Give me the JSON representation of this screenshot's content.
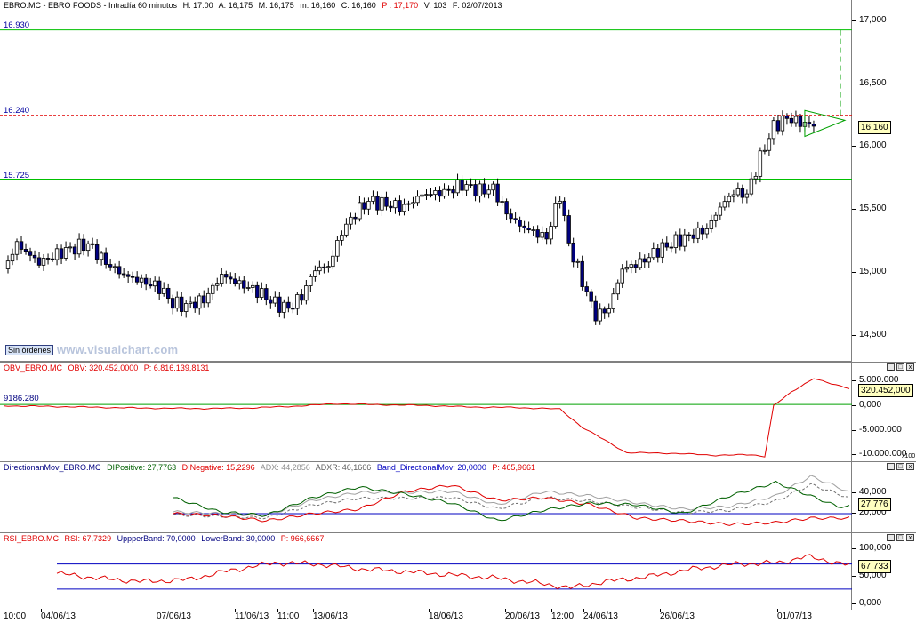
{
  "main": {
    "title_parts": [
      "EBRO.MC - EBRO FOODS - Intradía 60 minutos",
      "H: 17:00",
      "A: 16,175",
      "M: 16,175",
      "m: 16,160",
      "C: 16,160",
      "P : 17,170",
      "V: 103",
      "F: 02/07/2013"
    ],
    "y_ticks": [
      "17,000",
      "16,500",
      "16,000",
      "15,500",
      "15,000",
      "14,500"
    ],
    "last_value": "16,160",
    "levels": [
      {
        "label": "16.930",
        "value": 16.93,
        "color": "#00c000",
        "dash": false
      },
      {
        "label": "16.240",
        "value": 16.24,
        "color": "#e00000",
        "dash": true
      },
      {
        "label": "15.725",
        "value": 15.725,
        "color": "#00c000",
        "dash": false
      }
    ],
    "sin_ordenes": "Sin órdenes",
    "watermark": "www.visualchart.com"
  },
  "obv": {
    "title_parts": [
      "OBV_EBRO.MC",
      "OBV: 320.452,0000",
      "P: 6.816.139,8131"
    ],
    "left_label": "9186.280",
    "y_ticks": [
      "5.000.000",
      "0,000",
      "-5.000.000",
      "-10.000.000"
    ],
    "last_value": "320.452,000",
    "scale_note": "x100"
  },
  "dmi": {
    "title_parts": [
      "DirectionanMov_EBRO.MC",
      "DIPositive: 27,7763",
      "DINegative: 15,2296",
      "ADX: 44,2856",
      "ADXR: 46,1666",
      "Band_DirectionalMov: 20,0000",
      "P: 465,9661"
    ],
    "y_ticks": [
      "40,000",
      "20,000"
    ],
    "last_value": "27,776"
  },
  "rsi": {
    "title_parts": [
      "RSI_EBRO.MC",
      "RSI: 67,7329",
      "UppperBand: 70,0000",
      "LowerBand: 30,0000",
      "P: 966,6667"
    ],
    "y_ticks": [
      "100,000",
      "50,000",
      "0,000"
    ],
    "last_value": "67,733"
  },
  "x_labels": [
    "10:00",
    "04/06/13",
    "07/06/13",
    "11/06/13",
    "11:00",
    "13/06/13",
    "18/06/13",
    "20/06/13",
    "12:00",
    "24/06/13",
    "26/06/13",
    "01/07/13"
  ],
  "window_buttons": [
    "_",
    "□",
    "x"
  ],
  "colors": {
    "candle_up": "#ffffff",
    "candle_down": "#000080",
    "obv": "#e00000",
    "di_plus": "#006000",
    "di_minus": "#e00000",
    "adx": "#a0a0a0",
    "band": "#0000c0",
    "rsi": "#e00000"
  },
  "chart_data": {
    "type": "candlestick",
    "symbol": "EBRO.MC",
    "interval": "60 minutes",
    "ylim": [
      14.3,
      17.1
    ],
    "close_path": [
      [
        0,
        15.0
      ],
      [
        3,
        15.2
      ],
      [
        8,
        15.05
      ],
      [
        14,
        15.15
      ],
      [
        19,
        15.2
      ],
      [
        23,
        15.05
      ],
      [
        27,
        14.95
      ],
      [
        31,
        14.9
      ],
      [
        35,
        14.85
      ],
      [
        38,
        14.72
      ],
      [
        41,
        14.7
      ],
      [
        45,
        14.75
      ],
      [
        49,
        14.95
      ],
      [
        53,
        14.88
      ],
      [
        57,
        14.82
      ],
      [
        61,
        14.72
      ],
      [
        64,
        14.68
      ],
      [
        67,
        14.78
      ],
      [
        70,
        15.0
      ],
      [
        73,
        15.02
      ],
      [
        76,
        15.3
      ],
      [
        79,
        15.45
      ],
      [
        82,
        15.55
      ],
      [
        86,
        15.52
      ],
      [
        90,
        15.5
      ],
      [
        94,
        15.6
      ],
      [
        99,
        15.62
      ],
      [
        103,
        15.68
      ],
      [
        107,
        15.63
      ],
      [
        110,
        15.65
      ],
      [
        113,
        15.45
      ],
      [
        116,
        15.35
      ],
      [
        119,
        15.3
      ],
      [
        122,
        15.25
      ],
      [
        125,
        15.6
      ],
      [
        127,
        15.2
      ],
      [
        130,
        14.9
      ],
      [
        133,
        14.62
      ],
      [
        136,
        14.68
      ],
      [
        139,
        15.0
      ],
      [
        143,
        15.05
      ],
      [
        147,
        15.15
      ],
      [
        151,
        15.22
      ],
      [
        155,
        15.28
      ],
      [
        158,
        15.32
      ],
      [
        161,
        15.5
      ],
      [
        164,
        15.62
      ],
      [
        167,
        15.6
      ],
      [
        170,
        15.9
      ],
      [
        173,
        16.15
      ],
      [
        176,
        16.22
      ],
      [
        179,
        16.18
      ],
      [
        182,
        16.16
      ]
    ],
    "levels": [
      16.93,
      16.24,
      15.725
    ],
    "obv_path": [
      [
        0,
        -250000
      ],
      [
        15,
        -450000
      ],
      [
        30,
        -700000
      ],
      [
        45,
        -800000
      ],
      [
        55,
        -700000
      ],
      [
        65,
        -350000
      ],
      [
        75,
        150000
      ],
      [
        85,
        -50000
      ],
      [
        95,
        -200000
      ],
      [
        105,
        -500000
      ],
      [
        115,
        -600000
      ],
      [
        125,
        -900000
      ],
      [
        130,
        -4500000
      ],
      [
        140,
        -9500000
      ],
      [
        150,
        -9600000
      ],
      [
        160,
        -10000000
      ],
      [
        168,
        -9900000
      ],
      [
        171,
        -10200000
      ],
      [
        173,
        -250000
      ],
      [
        177,
        2400000
      ],
      [
        182,
        5200000
      ],
      [
        186,
        4000000
      ],
      [
        190,
        3200000
      ]
    ],
    "obv_ylim": [
      -11000000,
      6500000
    ],
    "dmi": {
      "di_plus": [
        [
          0,
          38
        ],
        [
          12,
          22
        ],
        [
          24,
          18
        ],
        [
          36,
          38
        ],
        [
          48,
          50
        ],
        [
          60,
          42
        ],
        [
          72,
          32
        ],
        [
          84,
          12
        ],
        [
          96,
          24
        ],
        [
          108,
          32
        ],
        [
          120,
          30
        ],
        [
          132,
          20
        ],
        [
          144,
          40
        ],
        [
          156,
          55
        ],
        [
          165,
          40
        ],
        [
          172,
          28
        ],
        [
          175,
          28
        ]
      ],
      "di_minus": [
        [
          0,
          20
        ],
        [
          12,
          18
        ],
        [
          24,
          12
        ],
        [
          36,
          20
        ],
        [
          48,
          25
        ],
        [
          60,
          45
        ],
        [
          72,
          52
        ],
        [
          84,
          35
        ],
        [
          96,
          38
        ],
        [
          108,
          30
        ],
        [
          120,
          15
        ],
        [
          132,
          12
        ],
        [
          144,
          8
        ],
        [
          156,
          10
        ],
        [
          165,
          15
        ],
        [
          172,
          15
        ],
        [
          175,
          15
        ]
      ],
      "adx": [
        [
          0,
          22
        ],
        [
          12,
          20
        ],
        [
          24,
          18
        ],
        [
          36,
          35
        ],
        [
          48,
          44
        ],
        [
          60,
          44
        ],
        [
          72,
          45
        ],
        [
          84,
          30
        ],
        [
          96,
          45
        ],
        [
          108,
          40
        ],
        [
          120,
          32
        ],
        [
          132,
          25
        ],
        [
          144,
          28
        ],
        [
          156,
          40
        ],
        [
          165,
          62
        ],
        [
          172,
          50
        ],
        [
          175,
          44
        ]
      ],
      "band": 20,
      "ylim": [
        0,
        70
      ]
    },
    "rsi": {
      "path": [
        [
          0,
          55
        ],
        [
          10,
          47
        ],
        [
          20,
          42
        ],
        [
          30,
          45
        ],
        [
          40,
          60
        ],
        [
          50,
          72
        ],
        [
          60,
          70
        ],
        [
          70,
          62
        ],
        [
          80,
          58
        ],
        [
          90,
          53
        ],
        [
          100,
          48
        ],
        [
          110,
          40
        ],
        [
          118,
          32
        ],
        [
          126,
          42
        ],
        [
          136,
          50
        ],
        [
          146,
          62
        ],
        [
          156,
          70
        ],
        [
          166,
          72
        ],
        [
          172,
          82
        ],
        [
          178,
          74
        ],
        [
          182,
          68
        ]
      ],
      "upper": 70,
      "lower": 30,
      "ylim": [
        0,
        105
      ]
    }
  }
}
